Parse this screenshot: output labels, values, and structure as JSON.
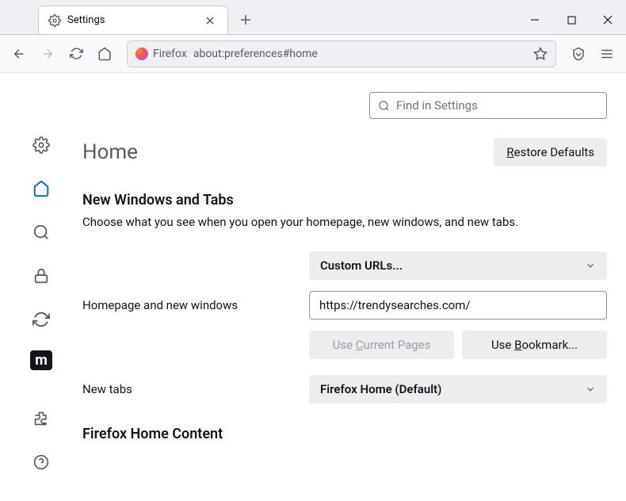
{
  "tab": {
    "title": "Settings"
  },
  "address": {
    "identity": "Firefox",
    "url": "about:preferences#home"
  },
  "search": {
    "placeholder": "Find in Settings"
  },
  "header": {
    "title": "Home",
    "restore": "Restore Defaults"
  },
  "section": {
    "title": "New Windows and Tabs",
    "desc": "Choose what you see when you open your homepage, new windows, and new tabs."
  },
  "homepage": {
    "dropdown": "Custom URLs...",
    "label": "Homepage and new windows",
    "url": "https://trendysearches.com/",
    "useCurrent": "Use Current Pages",
    "useBookmark": "Use Bookmark..."
  },
  "newtabs": {
    "label": "New tabs",
    "dropdown": "Firefox Home (Default)"
  },
  "section2": {
    "title": "Firefox Home Content"
  }
}
